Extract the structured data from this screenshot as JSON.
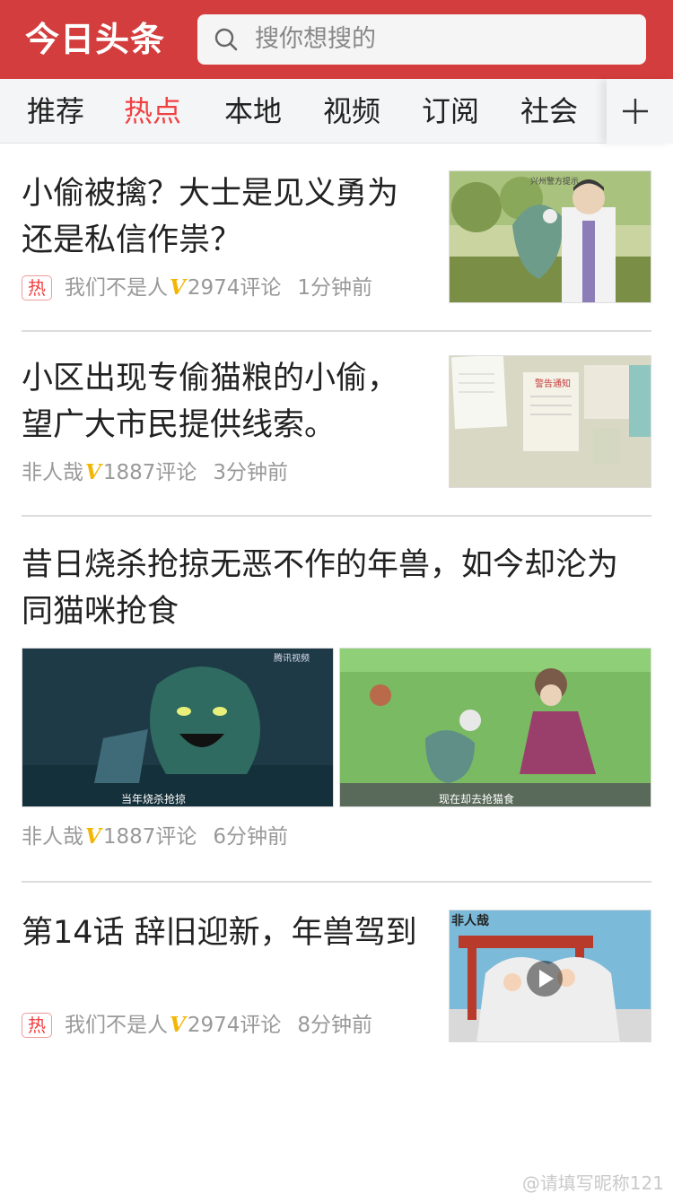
{
  "header": {
    "logo": "今日头条",
    "search_placeholder": "搜你想搜的"
  },
  "tabs": [
    {
      "label": "推荐",
      "active": false
    },
    {
      "label": "热点",
      "active": true
    },
    {
      "label": "本地",
      "active": false
    },
    {
      "label": "视频",
      "active": false
    },
    {
      "label": "订阅",
      "active": false
    },
    {
      "label": "社会",
      "active": false
    }
  ],
  "articles": [
    {
      "title_line1": "小偷被擒？大士是见义勇为",
      "title_line2": "还是私信作祟？",
      "badge": "热",
      "source": "我们不是人",
      "v": "V",
      "comments": "2974评论",
      "time": "1分钟前"
    },
    {
      "title_line1": "小区出现专偷猫粮的小偷，",
      "title_line2": "望广大市民提供线索。",
      "source": "非人哉",
      "v": "V",
      "comments": "1887评论",
      "time": "3分钟前",
      "thumb_text": "警告通知"
    },
    {
      "title_line1": "昔日烧杀抢掠无恶不作的年兽，如今却沦为",
      "title_line2": "同猫咪抢食",
      "source": "非人哉",
      "v": "V",
      "comments": "1887评论",
      "time": "6分钟前",
      "img1_caption": "当年烧杀抢掠",
      "img1_brand": "腾讯视频",
      "img2_caption": "现在却去抢猫食"
    },
    {
      "title": "第14话 辞旧迎新，年兽驾到",
      "badge": "热",
      "source": "我们不是人",
      "v": "V",
      "comments": "2974评论",
      "time": "8分钟前",
      "thumb_brand": "非人哉"
    }
  ],
  "watermark": "@请填写昵称121",
  "colors": {
    "brand_red": "#d43d3d",
    "active_tab": "#f04142",
    "verified_v": "#f2b705"
  }
}
